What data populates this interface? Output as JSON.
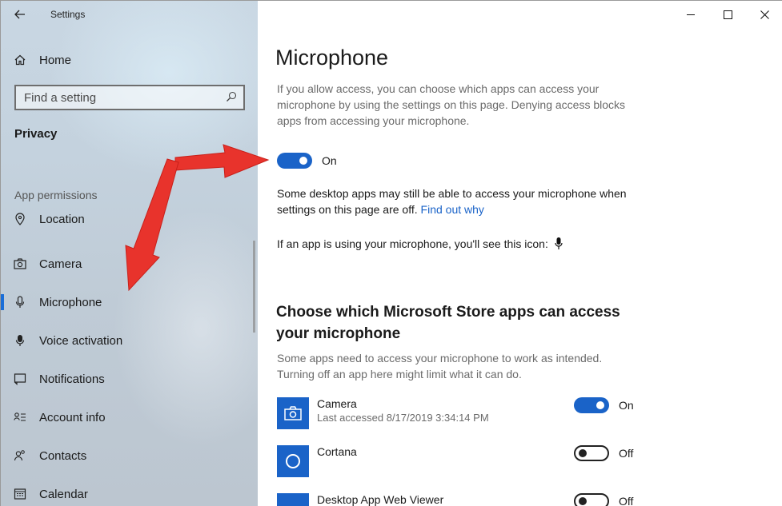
{
  "window": {
    "app_title": "Settings",
    "controls": [
      "minimize-icon",
      "maximize-icon",
      "close-icon"
    ]
  },
  "sidebar": {
    "home_label": "Home",
    "search_placeholder": "Find a setting",
    "section_title": "Privacy",
    "group_label": "App permissions",
    "items": [
      {
        "label": "Location",
        "icon": "location-icon"
      },
      {
        "label": "Camera",
        "icon": "camera-icon"
      },
      {
        "label": "Microphone",
        "icon": "microphone-icon",
        "active": true
      },
      {
        "label": "Voice activation",
        "icon": "voice-activation-icon"
      },
      {
        "label": "Notifications",
        "icon": "notifications-icon"
      },
      {
        "label": "Account info",
        "icon": "account-info-icon"
      },
      {
        "label": "Contacts",
        "icon": "contacts-icon"
      },
      {
        "label": "Calendar",
        "icon": "calendar-icon"
      }
    ]
  },
  "main": {
    "title": "Microphone",
    "description": "If you allow access, you can choose which apps can access your microphone by using the settings on this page. Denying access blocks apps from accessing your microphone.",
    "access_toggle": {
      "state": "On"
    },
    "desktop_note": "Some desktop apps may still be able to access your microphone when settings on this page are off.",
    "find_out_link": "Find out why",
    "icon_note": "If an app is using your microphone, you'll see this icon:",
    "store_heading": "Choose which Microsoft Store apps can access your microphone",
    "store_description": "Some apps need to access your microphone to work as intended. Turning off an app here might limit what it can do.",
    "apps": [
      {
        "name": "Camera",
        "sub": "Last accessed 8/17/2019 3:34:14 PM",
        "state": "On"
      },
      {
        "name": "Cortana",
        "sub": "",
        "state": "Off"
      },
      {
        "name": "Desktop App Web Viewer",
        "sub": "",
        "state": "Off"
      }
    ]
  },
  "colors": {
    "accent": "#1a63c8",
    "annotation_arrow": "#e8332c"
  }
}
